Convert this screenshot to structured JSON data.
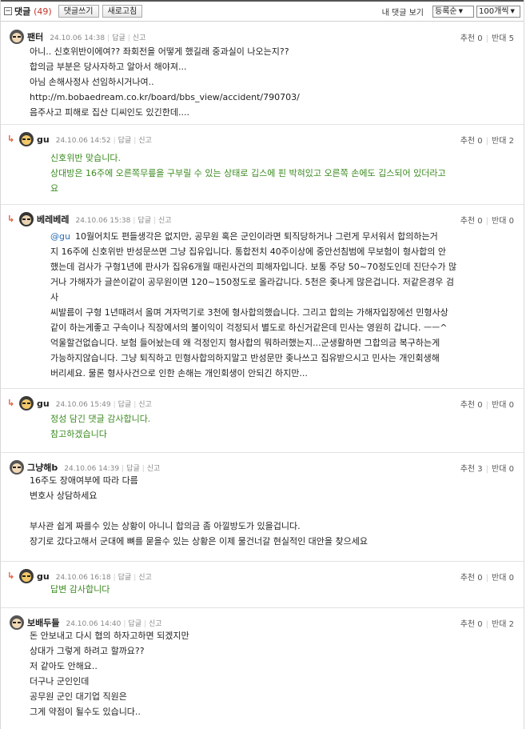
{
  "header": {
    "title": "댓글",
    "count": "(49)",
    "write_btn": "댓글쓰기",
    "refresh_btn": "새로고침",
    "my_comments": "내 댓글 보기",
    "sort_value": "등록순",
    "page_size_value": "100개씩"
  },
  "labels": {
    "reply": "답글",
    "report": "신고",
    "up": "추천",
    "down": "반대"
  },
  "comments": [
    {
      "nick": "팬터",
      "date": "24.10.06 14:38",
      "up": "0",
      "down": "5",
      "lines": [
        "아니.. 신호위반이에여?? 좌회전을 어떻게 했길래 중과실이 나오는지??",
        "합의금 부분은 당사자하고 알아서 해야져...",
        "아님 손해사정사 선임하시거나여..",
        "http://m.bobaedream.co.kr/board/bbs_view/accident/790703/",
        "음주사고 피해로 집산 디씨인도 있긴한데...."
      ]
    },
    {
      "nick": "gu",
      "date": "24.10.06 14:52",
      "up": "0",
      "down": "2",
      "lines": [
        "신호위반 맞습니다.",
        "상대방은 16주에 오른쪽무릎을 구부릴 수 있는 상태로 깁스에 핀 박혀있고 오른쪽 손에도 깁스되어 있더라고",
        "요"
      ]
    },
    {
      "nick": "베레베레",
      "date": "24.10.06 15:38",
      "up": "0",
      "down": "0",
      "mention": "@gu",
      "lines": [
        "10월어치도 편들생각은 없지만, 공무원 혹은 군인이라면 퇴직당하거나 그런게 무서워서 합의하는거",
        "지 16주에 신호위반 반성문쓰면 그냥 집유입니다. 통합전치 40주이상에 중안선침범에 무보험이 형사합의 안",
        "했는데 검사가 구형1년에 판사가 집유6개월 때린사건의 피해자입니다. 보통 주당 50~70정도인데 진단수가 많",
        "거나 가해자가 글쓴이같이 공무원이면 120~150정도로 올라갑니다. 5천은 좆나게 많은겁니다. 저같은경우 검",
        "사",
        "씨발름이 구형 1년때려서 올며 겨자먹기로 3천에 형사합의했습니다. 그리고 합의는 가해자입장에선 민형사상",
        "같이 하는게좋고 구속이나 직장에서의 불이익이 걱정되서 별도로 하신거같은데 민사는 영원히 갑니다. ㅡㅡ^",
        "억울할건없습니다. 보험 들어놨는데 왜 걱정인지 형사합의 뭐하러했는지...군생활하면 그합의금 복구하는게",
        "가능하지않습니다. 그냥 퇴직하고 민형사합의하지말고 반성문만 좆나쓰고 집유받으시고 민사는 개인회생해",
        "버리세요. 물론 형사사건으로 인한 손해는 개인회생이 안되긴 하지만..."
      ]
    },
    {
      "nick": "gu",
      "date": "24.10.06 15:49",
      "up": "0",
      "down": "0",
      "lines": [
        "정성 담긴 댓글 감사합니다.",
        "참고하겠습니다"
      ]
    },
    {
      "nick": "그냥해b",
      "date": "24.10.06 14:39",
      "up": "3",
      "down": "0",
      "lines": [
        "16주도 장애여부에 따라 다름",
        "변호사 상담하세요",
        "",
        "부사관 쉽게 짜를수 있는 상황이 아니니 합의금 좀 아낄방도가 있을겁니다.",
        "장기로 갔다고해서 군대에 뼈를 묻을수 있는 상황은 이제 물건너갈 현실적인 대안을 찾으세요"
      ]
    },
    {
      "nick": "gu",
      "date": "24.10.06 16:18",
      "up": "0",
      "down": "0",
      "lines": [
        "답변 감사합니다"
      ]
    },
    {
      "nick": "보배두들",
      "date": "24.10.06 14:40",
      "up": "0",
      "down": "2",
      "lines": [
        "돈 안보내고 다시 협의 하자고하면 되겠지만",
        "상대가 그렇게 하려고 할까요??",
        "저 같아도 안해요..",
        "더구나 군인인데",
        "공무원 군인 대기업 직원은",
        "그게 약점이 될수도 있습니다.."
      ]
    }
  ]
}
